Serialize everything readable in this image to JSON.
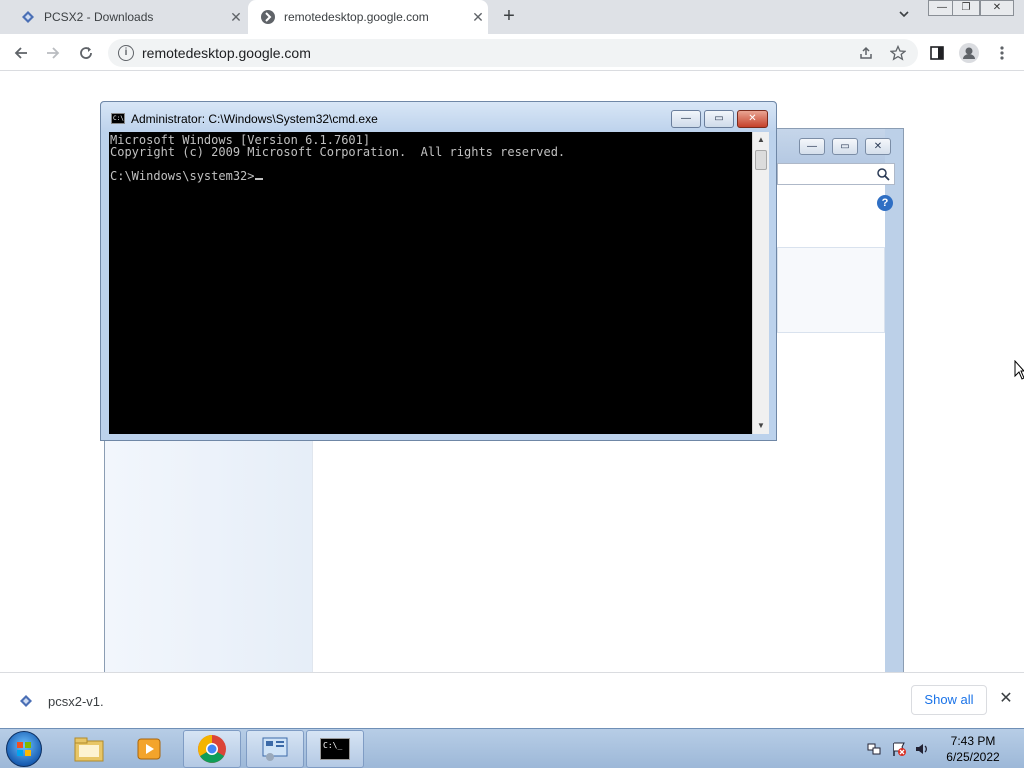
{
  "browser": {
    "tabs": [
      {
        "title": "PCSX2 - Downloads",
        "active": false
      },
      {
        "title": "remotedesktop.google.com",
        "active": true
      }
    ],
    "new_tab_label": "+",
    "address": "remotedesktop.google.com"
  },
  "cmd_window": {
    "title": "Administrator: C:\\Windows\\System32\\cmd.exe",
    "lines": [
      "Microsoft Windows [Version 6.1.7601]",
      "Copyright (c) 2009 Microsoft Corporation.  All rights reserved.",
      "",
      "C:\\Windows\\system32>"
    ]
  },
  "download_shelf": {
    "item_name": "pcsx2-v1.",
    "show_all_label": "Show all"
  },
  "taskbar": {
    "time": "7:43 PM",
    "date": "6/25/2022",
    "cmd_icon_text": "C:\\_"
  },
  "colors": {
    "console_bg": "#000000",
    "console_text": "#c0c0c0",
    "taskbar": "#9db8d8",
    "link_blue": "#1a73e8"
  }
}
